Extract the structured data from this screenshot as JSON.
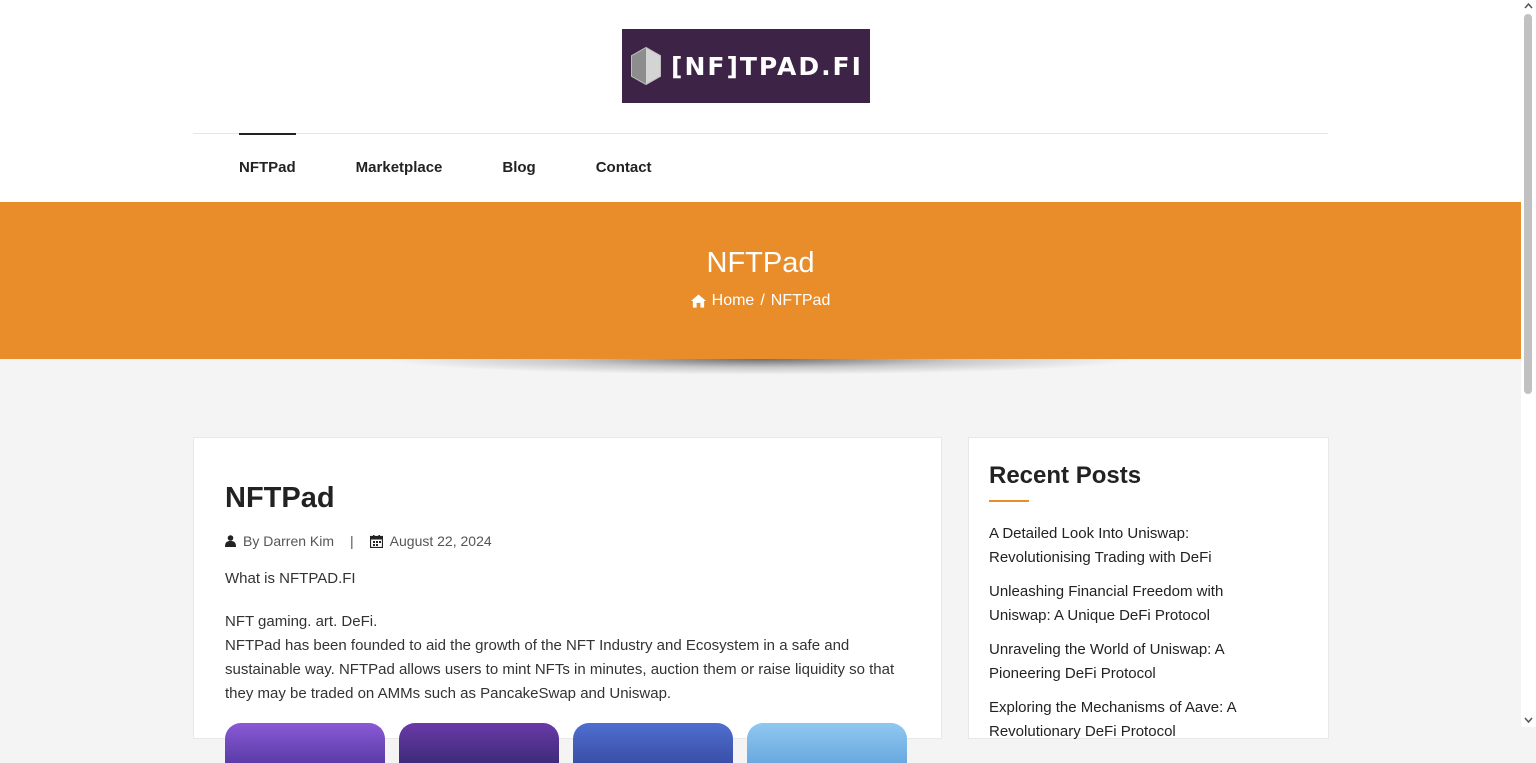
{
  "brand": {
    "logo_text": "[NF]TPAD.FI",
    "logo_bg": "#3d2346"
  },
  "nav": {
    "items": [
      {
        "label": "NFTPad",
        "active": true
      },
      {
        "label": "Marketplace"
      },
      {
        "label": "Blog"
      },
      {
        "label": "Contact"
      }
    ]
  },
  "hero": {
    "title": "NFTPad",
    "breadcrumb": {
      "home_label": "Home",
      "separator": "/",
      "current": "NFTPad"
    },
    "bg_color": "#e88d2a"
  },
  "post": {
    "title": "NFTPad",
    "author": "By Darren Kim",
    "meta_separator": "|",
    "date": "August 22, 2024",
    "intro": "What is NFTPAD.FI",
    "tagline": "NFT gaming. art. DeFi.",
    "body": "NFTPad has been founded to aid the growth of the NFT Industry and Ecosystem in a safe and sustainable way. NFTPad allows users to mint NFTs in minutes, auction them or raise liquidity so that they may be traded on AMMs such as PancakeSwap and Uniswap."
  },
  "sidebar": {
    "title": "Recent Posts",
    "accent": "#e88d2a",
    "posts": [
      "A Detailed Look Into Uniswap: Revolutionising Trading with DeFi",
      "Unleashing Financial Freedom with Uniswap: A Unique DeFi Protocol",
      "Unraveling the World of Uniswap: A Pioneering DeFi Protocol",
      "Exploring the Mechanisms of Aave: A Revolutionary DeFi Protocol"
    ]
  },
  "icons": {
    "logo": "hexagon-cube-icon",
    "home": "home-icon",
    "author": "user-icon",
    "date": "calendar-icon"
  }
}
